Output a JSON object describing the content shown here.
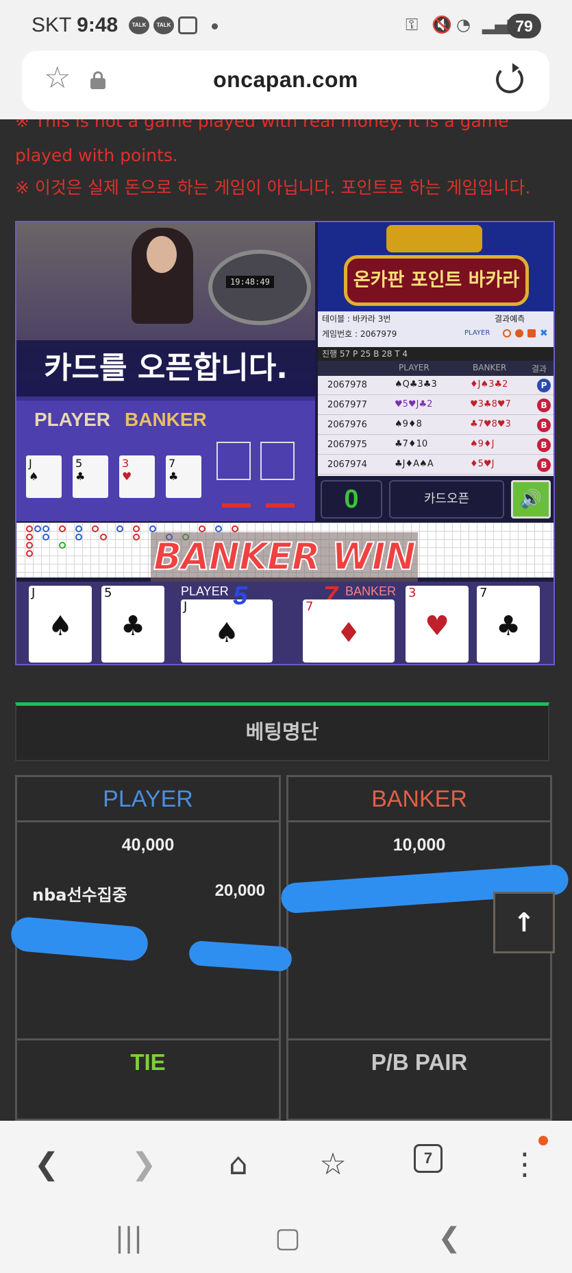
{
  "status_bar": {
    "carrier": "SKT",
    "time": "9:48",
    "talk_label": "TALK",
    "battery": "79"
  },
  "browser": {
    "url": "oncapan.com"
  },
  "notice": {
    "english": "※ This is not a game played with real money. It is a game played with points.",
    "korean": "※ 이것은 실제 돈으로 하는 게임이 아닙니다. 포인트로 하는 게임입니다."
  },
  "game": {
    "clock": "19:48:49",
    "logo_title": "온카판 포인트 바카라",
    "table_label": "테이블 : 바카라 3번",
    "game_no_label": "게임번호 : 2067979",
    "prediction_label": "결과예측",
    "prediction_player": "PLAYER",
    "stats": "진행 57  P 25  B 28  T 4",
    "open_message": "카드를 오픈합니다.",
    "felt_player": "PLAYER",
    "felt_banker": "BANKER",
    "results_header": {
      "player": "PLAYER",
      "banker": "BANKER",
      "result": "결과"
    },
    "results": [
      {
        "id": "2067978",
        "player": "♠Q♣3♣3",
        "banker": "♦J♠3♣2",
        "result": "P"
      },
      {
        "id": "2067977",
        "player": "♥5♥J♣2",
        "banker": "♥3♣8♥7",
        "result": "B"
      },
      {
        "id": "2067976",
        "player": "♠9♦8",
        "banker": "♣7♥8♥3",
        "result": "B"
      },
      {
        "id": "2067975",
        "player": "♣7♦10",
        "banker": "♠9♦J",
        "result": "B"
      },
      {
        "id": "2067974",
        "player": "♣J♦A♠A",
        "banker": "♦5♥J",
        "result": "B"
      }
    ],
    "count": "0",
    "card_open_button": "카드오픈",
    "win_banner": "BANKER WIN",
    "player_score_label": "PLAYER",
    "player_score": "5",
    "banker_score_label": "BANKER",
    "banker_score": "7",
    "player_cards": [
      {
        "rank": "J",
        "suit": "♠",
        "color": "black"
      },
      {
        "rank": "5",
        "suit": "♣",
        "color": "black"
      },
      {
        "rank": "J",
        "suit": "♠",
        "color": "black"
      }
    ],
    "banker_cards": [
      {
        "rank": "7",
        "suit": "♦",
        "color": "red"
      },
      {
        "rank": "3",
        "suit": "♥",
        "color": "red"
      },
      {
        "rank": "7",
        "suit": "♣",
        "color": "black"
      }
    ]
  },
  "betting": {
    "title": "베팅명단",
    "player": {
      "label": "PLAYER",
      "total": "40,000",
      "color": "#4a8ee0",
      "entries": [
        {
          "name": "nba선수집중",
          "amount": "20,000"
        }
      ]
    },
    "banker": {
      "label": "BANKER",
      "total": "10,000",
      "color": "#e0604a"
    },
    "tie": {
      "label": "TIE",
      "color": "#7ed03a"
    },
    "pair": {
      "label": "P/B PAIR",
      "color": "#c8c8c8"
    }
  },
  "scroll_top_icon": "arrow-up-icon",
  "nav": {
    "tabs_count": "7"
  },
  "colors": {
    "notice_red": "#e0302a",
    "accent_green": "#19c05a",
    "redaction_blue": "#2f8ff0"
  }
}
